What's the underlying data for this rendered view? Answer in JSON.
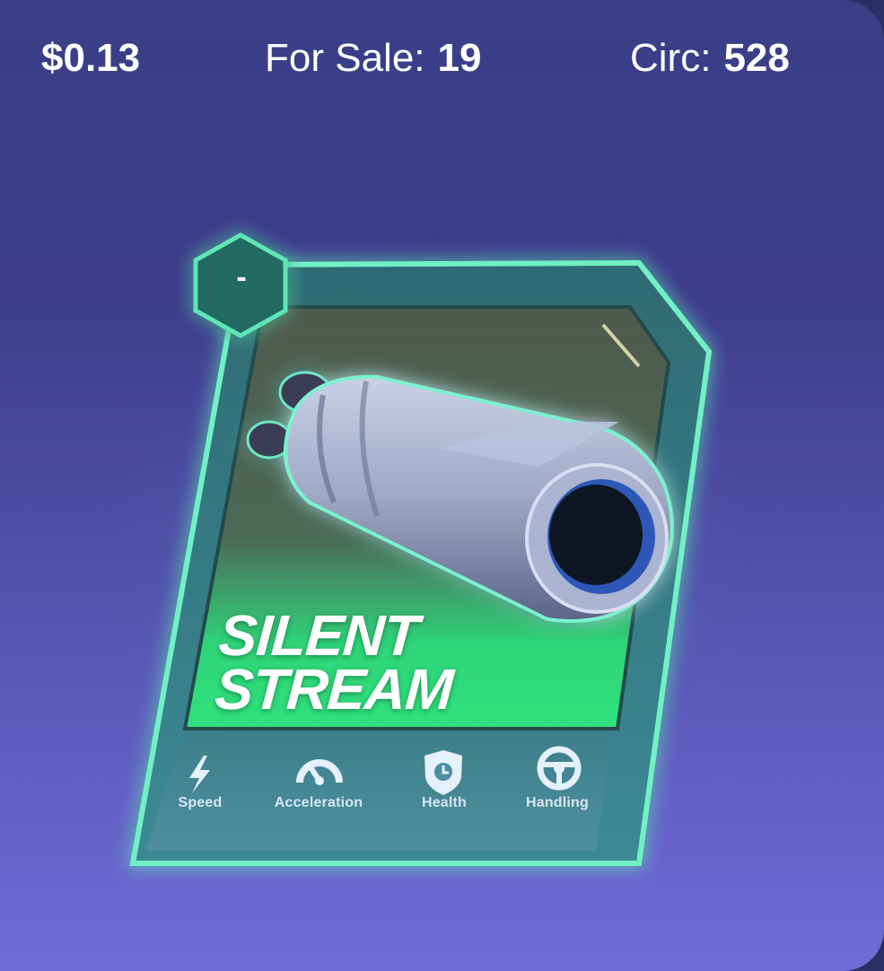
{
  "stats": {
    "price": "$0.13",
    "for_sale_label": "For Sale:",
    "for_sale_value": "19",
    "circ_label": "Circ:",
    "circ_value": "528"
  },
  "card": {
    "rating": "-",
    "title_line1": "SILENT",
    "title_line2": "STREAM",
    "item_icon": "exhaust-booster-icon",
    "attributes": [
      {
        "label": "Speed",
        "icon": "lightning-icon"
      },
      {
        "label": "Acceleration",
        "icon": "speedometer-icon"
      },
      {
        "label": "Health",
        "icon": "shield-clock-icon"
      },
      {
        "label": "Handling",
        "icon": "steering-wheel-icon"
      }
    ]
  },
  "colors": {
    "background_top": "#3a3f87",
    "background_bottom": "#6f6cd8",
    "card_frame": "#3a8f8a",
    "card_glow": "#4ee6b0",
    "title_band": "#2ee07a"
  }
}
